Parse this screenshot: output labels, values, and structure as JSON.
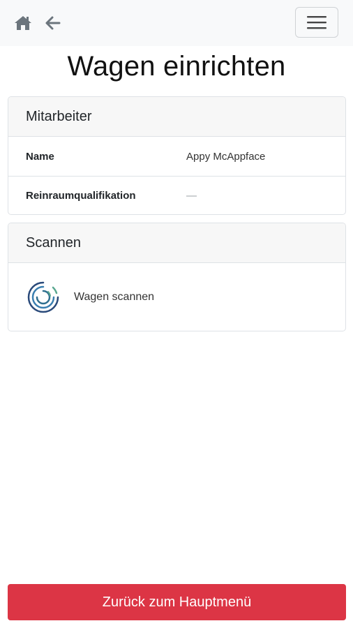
{
  "navbar": {
    "home_icon": "home-icon",
    "back_icon": "arrow-left-icon",
    "menu_icon": "hamburger-icon"
  },
  "page": {
    "title": "Wagen einrichten"
  },
  "employee_card": {
    "header": "Mitarbeiter",
    "rows": [
      {
        "label": "Name",
        "value": "Appy McAppface"
      },
      {
        "label": "Reinraumqualifikation",
        "value": "—"
      }
    ]
  },
  "scan_card": {
    "header": "Scannen",
    "items": [
      {
        "icon": "scan-icon",
        "label": "Wagen scannen"
      }
    ]
  },
  "footer": {
    "button_label": "Zurück zum Hauptmenü",
    "button_color": "#dc3545"
  }
}
